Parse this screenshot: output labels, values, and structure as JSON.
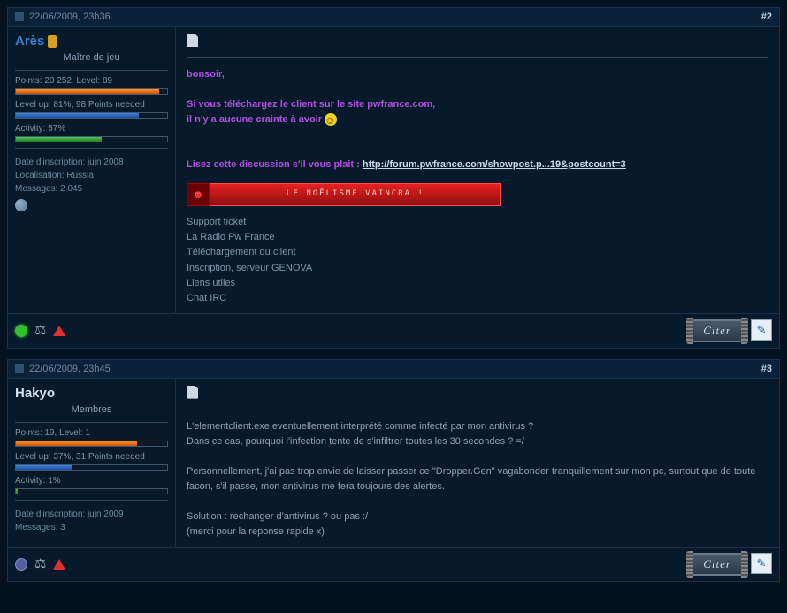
{
  "posts": [
    {
      "date": "22/06/2009, 23h36",
      "num_prefix": "#",
      "num": "2",
      "user": {
        "name": "Arès",
        "color_class": "user-blue",
        "has_medal": true,
        "title": "Maître de jeu",
        "points_line": "Points: 20 252, Level: 89",
        "points_pct": 95,
        "levelup_line": "Level up: 81%, 98 Points needed",
        "levelup_pct": 81,
        "activity_line": "Activity: 57%",
        "activity_pct": 57,
        "join": "Date d'inscription: juin 2008",
        "location": "Localisation: Russia",
        "messages": "Messages: 2 045",
        "has_globe": true,
        "online": true
      },
      "body": {
        "greeting": "bonsoir,",
        "line1": "Si vous téléchargez le client sur le site pwfrance.com,",
        "line2": "il n'y a aucune crainte à avoir ",
        "read_prefix": "Lisez cette discussion s'il vous plait : ",
        "read_link": "http://forum.pwfrance.com/showpost.p...19&postcount=3",
        "banner_face": "☻",
        "banner_text": "le noëlisme vaincra !",
        "sig_lines": [
          "Support ticket",
          "La Radio Pw France",
          "Téléchargement du client",
          "Inscription, serveur GENOVA",
          "Liens utiles",
          "Chat IRC"
        ]
      },
      "actions": {
        "quote": "Citer",
        "edit": "✎"
      }
    },
    {
      "date": "22/06/2009, 23h45",
      "num_prefix": "#",
      "num": "3",
      "user": {
        "name": "Hakyo",
        "color_class": "user-white",
        "has_medal": false,
        "title": "Membres",
        "points_line": "Points: 19, Level: 1",
        "points_pct": 80,
        "levelup_line": "Level up: 37%, 31 Points needed",
        "levelup_pct": 37,
        "activity_line": "Activity: 1%",
        "activity_pct": 1,
        "join": "Date d'inscription: juin 2009",
        "location": "",
        "messages": "Messages: 3",
        "has_globe": false,
        "online": false
      },
      "body": {
        "p1": "L'elementclient.exe eventuellement interprété comme infecté par mon antivirus ?",
        "p2": "Dans ce cas, pourquoi l'infection tente de s'infiltrer toutes les 30 secondes ? =/",
        "p3": "Personnellement, j'ai pas trop envie de laisser passer ce \"Dropper.Gen\" vagabonder tranquillement sur mon pc, surtout que de toute facon, s'il passe, mon antivirus me fera toujours des alertes.",
        "p4": "Solution : rechanger d'antivirus ? ou pas :/",
        "p5": "(merci pour la reponse rapide x)"
      },
      "actions": {
        "quote": "Citer",
        "edit": "✎"
      }
    }
  ]
}
